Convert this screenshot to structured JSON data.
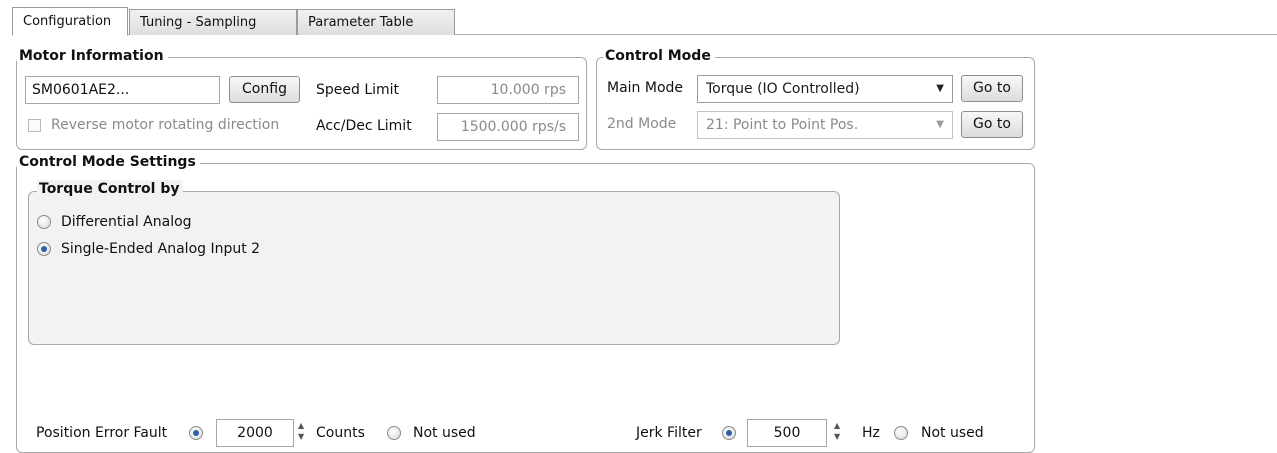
{
  "tabs": [
    {
      "label": "Configuration",
      "active": true
    },
    {
      "label": "Tuning - Sampling",
      "active": false
    },
    {
      "label": "Parameter Table",
      "active": false
    }
  ],
  "motor_information": {
    "title": "Motor Information",
    "motor_name": "SM0601AE2...",
    "config_label": "Config",
    "speed_limit_label": "Speed Limit",
    "speed_limit_value": "10.000 rps",
    "reverse_label": "Reverse motor rotating direction",
    "reverse_checked": false,
    "accdec_label": "Acc/Dec Limit",
    "accdec_value": "1500.000 rps/s"
  },
  "control_mode": {
    "title": "Control Mode",
    "main_mode_label": "Main Mode",
    "main_mode_value": "Torque (IO Controlled)",
    "second_mode_label": "2nd Mode",
    "second_mode_value": "21: Point to Point Pos.",
    "goto_label": "Go to"
  },
  "control_mode_settings": {
    "title": "Control Mode Settings",
    "torque_control": {
      "title": "Torque Control by",
      "options": [
        {
          "label": "Differential Analog",
          "selected": false
        },
        {
          "label": "Single-Ended Analog Input 2",
          "selected": true
        }
      ]
    },
    "position_error_fault": {
      "label": "Position Error Fault",
      "value": "2000",
      "unit": "Counts",
      "not_used_label": "Not used",
      "enabled": true
    },
    "jerk_filter": {
      "label": "Jerk Filter",
      "value": "500",
      "unit": "Hz",
      "not_used_label": "Not used",
      "enabled": true
    }
  }
}
